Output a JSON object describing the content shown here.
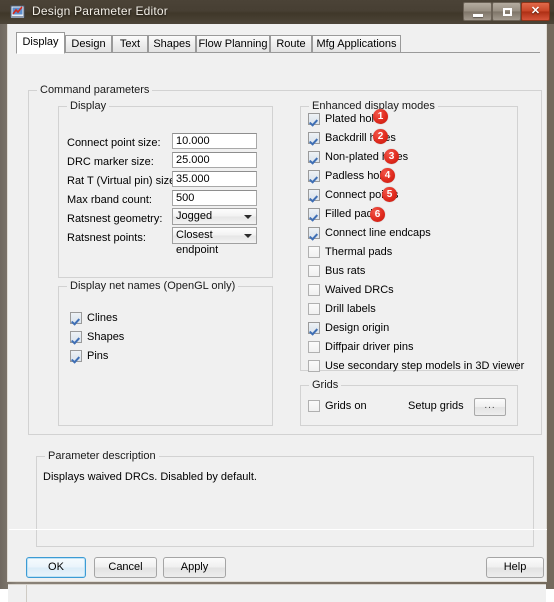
{
  "window": {
    "title": "Design Parameter Editor",
    "icon": "app-chart-icon",
    "controls": {
      "minimize": "minimize-icon",
      "maximize": "maximize-icon",
      "close": "✕"
    }
  },
  "tabs": [
    {
      "label": "Display",
      "selected": true
    },
    {
      "label": "Design",
      "selected": false
    },
    {
      "label": "Text",
      "selected": false
    },
    {
      "label": "Shapes",
      "selected": false
    },
    {
      "label": "Flow Planning",
      "selected": false
    },
    {
      "label": "Route",
      "selected": false
    },
    {
      "label": "Mfg Applications",
      "selected": false
    }
  ],
  "groups": {
    "command_parameters": "Command parameters",
    "display": "Display",
    "net_names": "Display net names (OpenGL only)",
    "enhanced": "Enhanced display modes",
    "grids": "Grids",
    "param_desc": "Parameter description"
  },
  "display_fields": [
    {
      "label": "Connect point size:",
      "value": "10.000",
      "type": "text"
    },
    {
      "label": "DRC marker size:",
      "value": "25.000",
      "type": "text"
    },
    {
      "label": "Rat T (Virtual pin) size:",
      "value": "35.000",
      "type": "text"
    },
    {
      "label": "Max rband count:",
      "value": "500",
      "type": "text"
    },
    {
      "label": "Ratsnest geometry:",
      "value": "Jogged",
      "type": "combo"
    },
    {
      "label": "Ratsnest points:",
      "value": "Closest endpoint",
      "type": "combo"
    }
  ],
  "net_name_options": [
    {
      "label": "Clines",
      "checked": true
    },
    {
      "label": "Shapes",
      "checked": true
    },
    {
      "label": "Pins",
      "checked": true
    }
  ],
  "enhanced_options": [
    {
      "label": "Plated holes",
      "checked": true,
      "badge": "1"
    },
    {
      "label": "Backdrill holes",
      "checked": true,
      "badge": "2"
    },
    {
      "label": "Non-plated holes",
      "checked": true,
      "badge": "3"
    },
    {
      "label": "Padless holes",
      "checked": true,
      "badge": "4"
    },
    {
      "label": "Connect points",
      "checked": true,
      "badge": "5"
    },
    {
      "label": "Filled pads",
      "checked": true,
      "badge": "6"
    },
    {
      "label": "Connect line endcaps",
      "checked": true,
      "badge": ""
    },
    {
      "label": "Thermal pads",
      "checked": false,
      "badge": ""
    },
    {
      "label": "Bus rats",
      "checked": false,
      "badge": ""
    },
    {
      "label": "Waived DRCs",
      "checked": false,
      "badge": ""
    },
    {
      "label": "Drill labels",
      "checked": false,
      "badge": ""
    },
    {
      "label": "Design origin",
      "checked": true,
      "badge": ""
    },
    {
      "label": "Diffpair driver pins",
      "checked": false,
      "badge": ""
    },
    {
      "label": "Use secondary step models in 3D viewer",
      "checked": false,
      "badge": ""
    }
  ],
  "grids": {
    "grids_on_label": "Grids on",
    "grids_on_checked": false,
    "setup_label": "Setup grids",
    "setup_button": "..."
  },
  "parameter_description": {
    "text": "Displays waived DRCs. Disabled by default."
  },
  "buttons": {
    "ok": "OK",
    "cancel": "Cancel",
    "apply": "Apply",
    "help": "Help"
  },
  "colors": {
    "badge_red": "#e02b1e",
    "titlebar": "#473f33",
    "close_button": "#c84527",
    "default_button_focus": "#3c9bd4",
    "dialog_face": "#f0f0f0"
  }
}
